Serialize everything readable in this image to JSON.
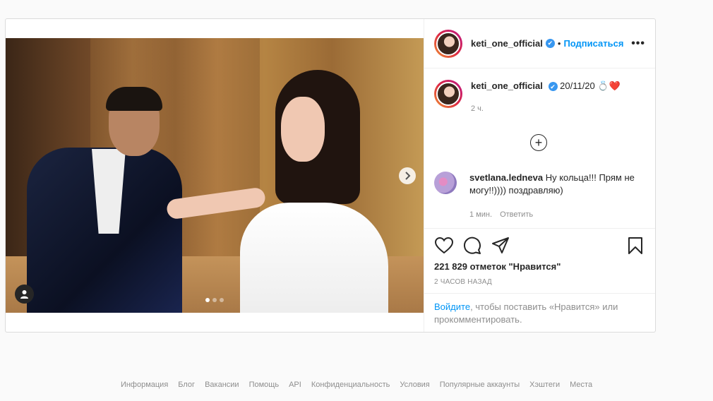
{
  "post": {
    "username": "keti_one_official",
    "follow_label": "Подписаться",
    "separator": "•",
    "more_label": "•••",
    "caption_text": "20/11/20 💍❤️",
    "caption_time": "2 ч.",
    "load_more": "+",
    "comment": {
      "username": "svetlana.ledneva",
      "text": "Ну кольца!!! Прям не могу!!)))) поздравляю)",
      "time": "1 мин.",
      "reply_label": "Ответить"
    },
    "likes": "221 829 отметок \"Нравится\"",
    "posted_ago": "2 ЧАСОВ НАЗАД",
    "login_link": "Войдите",
    "login_text": ", чтобы поставить «Нравится» или прокомментировать."
  },
  "icons": {
    "like": "heart-icon",
    "comment": "comment-icon",
    "share": "share-icon",
    "save": "bookmark-icon",
    "next": "chevron-right-icon",
    "tag": "user-tag-icon"
  },
  "colors": {
    "link": "#0095f6",
    "muted": "#8e8e8e",
    "text": "#262626",
    "verified": "#3897f0"
  },
  "carousel": {
    "total": 3,
    "current": 1
  },
  "footer": {
    "links": [
      "Информация",
      "Блог",
      "Вакансии",
      "Помощь",
      "API",
      "Конфиденциальность",
      "Условия",
      "Популярные аккаунты",
      "Хэштеги",
      "Места"
    ]
  }
}
